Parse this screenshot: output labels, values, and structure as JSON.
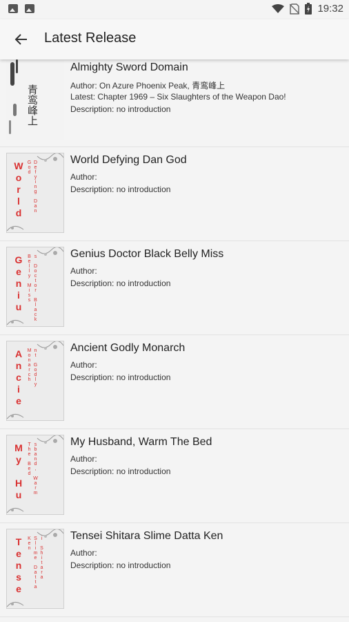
{
  "status_bar": {
    "time": "19:32"
  },
  "app_bar": {
    "title": "Latest Release"
  },
  "books": [
    {
      "title": "Almighty Sword Domain",
      "author": "Author: On Azure Phoenix Peak, 青鸾峰上",
      "latest": "Latest: Chapter 1969 – Six Slaughters of the Weapon Dao!",
      "description": "Description: no introduction",
      "cover_text": "青鸾峰上"
    },
    {
      "title": "World Defying Dan God",
      "author": "Author:",
      "description": "Description: no introduction",
      "cover_big": "World",
      "cover_small": "Defying Dan God"
    },
    {
      "title": "Genius Doctor Black Belly Miss",
      "author": "Author:",
      "description": "Description: no introduction",
      "cover_big": "Geniu",
      "cover_small": "s Doctor Black Belly Miss"
    },
    {
      "title": "Ancient Godly Monarch",
      "author": "Author:",
      "description": "Description: no introduction",
      "cover_big": "Ancie",
      "cover_small": "nt Godly Monarch"
    },
    {
      "title": "My Husband, Warm The Bed",
      "author": "Author:",
      "description": "Description: no introduction",
      "cover_big": "My Hu",
      "cover_small": "sband, Warm The Bed"
    },
    {
      "title": "Tensei Shitara Slime Datta Ken",
      "author": "Author:",
      "description": "Description: no introduction",
      "cover_big": "Tense",
      "cover_small": "i Shitara Slime Datta Ken"
    }
  ]
}
